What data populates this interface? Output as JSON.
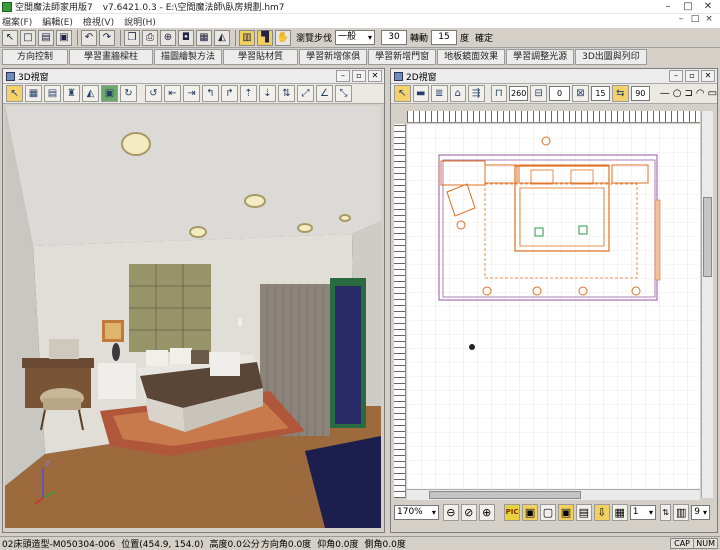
{
  "app": {
    "title": "空間魔法師家用版7",
    "version_path": "v7.6421.0.3 - E:\\空間魔法師\\臥房規劃.hm7"
  },
  "menu": [
    "檔案(F)",
    "編輯(E)",
    "檢視(V)",
    "說明(H)"
  ],
  "toolbar": {
    "walk_label": "瀏覽步伐",
    "walk_mode": "一般",
    "step_value": "30",
    "rotate_label": "轉動",
    "rotate_value": "15",
    "degree_label": "度",
    "confirm_label": "確定"
  },
  "tutorials": [
    "方向控制",
    "學習畫牆樑柱",
    "描圖繪製方法",
    "學習貼材質",
    "學習新增傢俱",
    "學習新增門窗",
    "地板鏡面效果",
    "學習調整光源",
    "3D出圖與列印"
  ],
  "pane3d": {
    "title": "3D視窗"
  },
  "pane2d": {
    "title": "2D視窗",
    "field1": "260",
    "field2": "0",
    "field3": "15",
    "field4": "90"
  },
  "zoom": {
    "value": "170%",
    "page_value": "1",
    "count_value": "9"
  },
  "status": {
    "model": "02床頭造型-M050304-006",
    "position": "位置(454.9, 154.0)",
    "height": "高度0.0公分",
    "direction": "方向角0.0度",
    "elevation": "仰角0.0度",
    "tilt": "側角0.0度",
    "cap": "CAP",
    "num": "NUM"
  },
  "colors": {
    "wall_dark": "#1c1e4e",
    "floor": "#9c6a3c",
    "plan_line": "#e07020",
    "accent": "#f2d060"
  }
}
